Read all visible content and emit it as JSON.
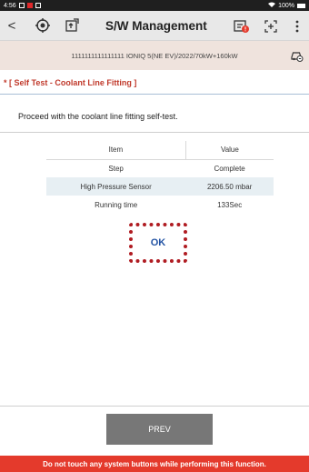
{
  "status_bar": {
    "time": "4:56",
    "battery": "100%"
  },
  "header": {
    "title": "S/W Management",
    "back": "<"
  },
  "vehicle_info": {
    "text": "1111111111111111 IONIQ 5(NE EV)/2022/70kW+160kW"
  },
  "section_title": "* [ Self Test - Coolant Line Fitting ]",
  "description": "Proceed with the coolant line fitting self-test.",
  "table": {
    "headers": [
      "Item",
      "Value"
    ],
    "rows": [
      {
        "item": "Step",
        "value": "Complete"
      },
      {
        "item": "High Pressure Sensor",
        "value": "2206.50 mbar"
      },
      {
        "item": "Running time",
        "value": "133Sec"
      }
    ]
  },
  "ok_label": "OK",
  "prev_label": "PREV",
  "warning": "Do not touch any system buttons while performing this function.",
  "colors": {
    "accent_red": "#e43a2c",
    "ok_blue": "#2454a4",
    "header_bg": "#e8e8e8"
  }
}
